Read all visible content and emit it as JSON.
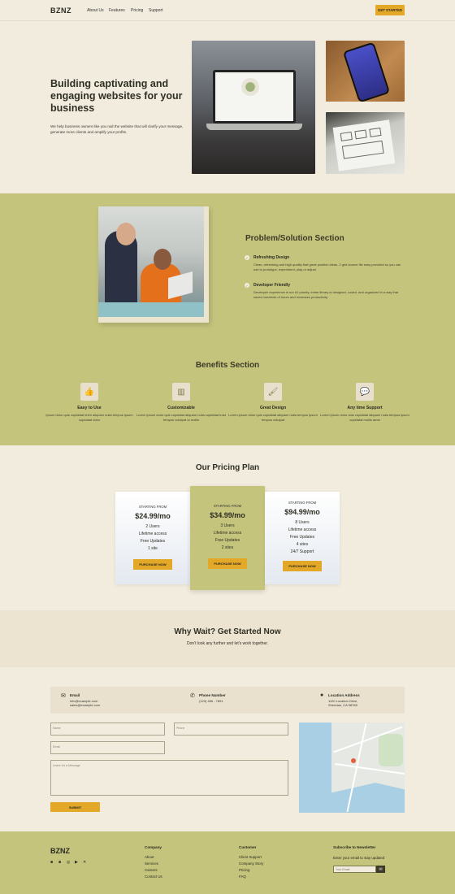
{
  "header": {
    "logo": "BZNZ",
    "nav": [
      "About Us",
      "Features",
      "Pricing",
      "Support"
    ],
    "cta": "GET STARTED"
  },
  "hero": {
    "title": "Building captivating and engaging websites for your business",
    "subtitle": "We help business owners like you nail the website that will clarify your message, generate more clients and amplify your profits."
  },
  "problem": {
    "title": "Problem/Solution Section",
    "features": [
      {
        "title": "Refreshing Design",
        "desc": "Clean, refreshing and high quality that great position ideas. 2 grid source file easy provided so you can use to prototype, experiment, play or adjust."
      },
      {
        "title": "Developer Friendly",
        "desc": "Developer experience is our #1 priority, entire library is designed, coded, and organized in a way that saves hundreds of hours and increases productivity."
      }
    ]
  },
  "benefits": {
    "title": "Benefits Section",
    "items": [
      {
        "icon": "thumbs-up-icon",
        "glyph": "👍",
        "name": "Easy to Use",
        "desc": "Ipsum dolor quis cupidatat enim aliquam nulla tempus ipsum cupidatat dolor"
      },
      {
        "icon": "layout-icon",
        "glyph": "▥",
        "name": "Customizable",
        "desc": "Lorem ipsum dolor quis cupidatat aliquam nulla cupidatat trust tempus volutpat ut mollis"
      },
      {
        "icon": "paint-roller-icon",
        "glyph": "🖌",
        "name": "Great Design",
        "desc": "Lorem ipsum dolor quis cupidatat aliquam nulla tempus ipsum tempus volutpat"
      },
      {
        "icon": "chat-icon",
        "glyph": "💬",
        "name": "Any time Support",
        "desc": "Lorem ipsum dolor duis cupidatat aliquam nulla tempus ipsum cupidatat mollis amet"
      }
    ]
  },
  "pricing": {
    "title": "Our Pricing Plan",
    "plans": [
      {
        "from": "STARTING FROM",
        "price": "$24.99/mo",
        "features": [
          "2 Users",
          "Lifetime access",
          "Free Updates",
          "1 site"
        ],
        "button": "PURCHASE NOW"
      },
      {
        "from": "STARTING FROM",
        "price": "$34.99/mo",
        "features": [
          "3 Users",
          "Lifetime access",
          "Free Updates",
          "2 sites"
        ],
        "button": "PURCHASE NOW"
      },
      {
        "from": "STARTING FROM",
        "price": "$94.99/mo",
        "features": [
          "8 Users",
          "Lifetime access",
          "Free Updates",
          "4 sites",
          "24/7 Support"
        ],
        "button": "PURCHASE NOW"
      }
    ]
  },
  "cta_band": {
    "title": "Why Wait? Get Started Now",
    "subtitle": "Don't look any further and let's work together."
  },
  "contact": {
    "email_label": "Email",
    "email_lines": [
      "info@example.com",
      "sales@example.com"
    ],
    "phone_label": "Phone Number",
    "phone": "(123) 456 - 7891",
    "location_label": "Location Address",
    "location_lines": [
      "1100 Location Drive,",
      "Sheridan, CA 98765"
    ],
    "name_placeholder": "Name",
    "phone_placeholder": "Phone",
    "email_placeholder": "Email",
    "message_placeholder": "Leave Us a Message",
    "submit": "SUBMIT"
  },
  "footer": {
    "logo": "BZNZ",
    "company_heading": "Company",
    "company_links": [
      "About",
      "Services",
      "Careers",
      "Contact Us"
    ],
    "customer_heading": "Customer",
    "customer_links": [
      "Client Support",
      "Company Story",
      "Pricing",
      "FAQ"
    ],
    "newsletter_heading": "Subscribe to Newsletter",
    "newsletter_text": "Enter your email to stay updated",
    "newsletter_placeholder": "Your Email"
  },
  "colors": {
    "background": "#f2ecdf",
    "olive": "#c4c47c",
    "accent": "#e4a828",
    "dark": "#2f2f24"
  }
}
